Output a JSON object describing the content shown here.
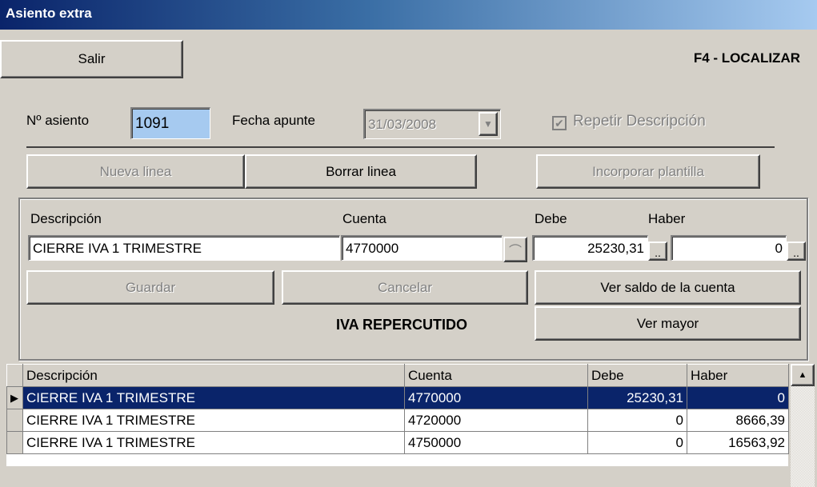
{
  "window": {
    "title": "Asiento extra"
  },
  "toolbar": {
    "exit_label": "Salir",
    "shortcut_hint": "F4 - LOCALIZAR"
  },
  "header": {
    "entry_number_label": "Nº asiento",
    "entry_number_value": "1091",
    "date_label": "Fecha apunte",
    "date_value": "31/03/2008",
    "repeat_description_label": "Repetir Descripción",
    "repeat_description_checked": true
  },
  "actions": {
    "new_line_label": "Nueva linea",
    "delete_line_label": "Borrar linea",
    "add_template_label": "Incorporar plantilla"
  },
  "editor": {
    "description_label": "Descripción",
    "description_value": "CIERRE IVA 1 TRIMESTRE",
    "account_label": "Cuenta",
    "account_value": "4770000",
    "debit_label": "Debe",
    "debit_value": "25230,31",
    "credit_label": "Haber",
    "credit_value": "0",
    "ellipsis": "..",
    "save_label": "Guardar",
    "cancel_label": "Cancelar",
    "view_balance_label": "Ver saldo de la cuenta",
    "view_ledger_label": "Ver mayor",
    "account_name": "IVA REPERCUTIDO"
  },
  "grid": {
    "columns": [
      "Descripción",
      "Cuenta",
      "Debe",
      "Haber"
    ],
    "rows": [
      [
        "CIERRE IVA 1 TRIMESTRE",
        "4770000",
        "25230,31",
        "0"
      ],
      [
        "CIERRE IVA 1 TRIMESTRE",
        "4720000",
        "0",
        "8666,39"
      ],
      [
        "CIERRE IVA 1 TRIMESTRE",
        "4750000",
        "0",
        "16563,92"
      ]
    ],
    "selected_row": 0
  },
  "colors": {
    "selection": "#0a246a",
    "input_highlight": "#a6caf0",
    "face": "#d4d0c8"
  }
}
